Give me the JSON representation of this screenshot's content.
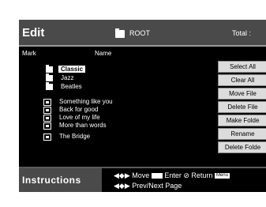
{
  "header": {
    "title": "Edit",
    "path": "ROOT",
    "total": "Total :"
  },
  "columns": {
    "mark": "Mark",
    "name": "Name"
  },
  "folders": [
    {
      "label": "Classic",
      "selected": true
    },
    {
      "label": "Jazz"
    },
    {
      "label": "Beatles"
    }
  ],
  "files": [
    {
      "label": "Something like you"
    },
    {
      "label": "Back for good"
    },
    {
      "label": "Love of my life"
    },
    {
      "label": "More than words"
    },
    {
      "label": "The Bridge"
    }
  ],
  "buttons": {
    "select_all": "Select All",
    "clear_all": "Clear All",
    "move_file": "Move File",
    "delete_file": "Delete File",
    "make_folder": "Make Folde",
    "rename": "Rename",
    "delete_folder": "Delete Folde"
  },
  "footer": {
    "label": "Instructions",
    "move": "Move",
    "enter": "Enter",
    "return_label": "Return",
    "menu_key": "Menu",
    "prev_next": "Prev/Next Page",
    "move_glyph": "◀◆▶",
    "page_glyph": "◀◆▶"
  }
}
